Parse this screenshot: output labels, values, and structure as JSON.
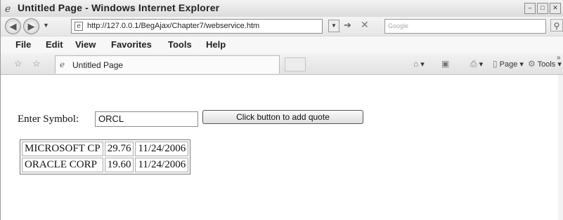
{
  "window": {
    "title": "Untitled Page - Windows Internet Explorer"
  },
  "address": {
    "url": "http://127.0.0.1/BegAjax/Chapter7/webservice.htm",
    "search_placeholder": "Google"
  },
  "menu": {
    "items": [
      "File",
      "Edit",
      "View",
      "Favorites",
      "Tools",
      "Help"
    ]
  },
  "tab": {
    "title": "Untitled Page"
  },
  "commands": {
    "page": "Page ▾",
    "tools": "Tools ▾"
  },
  "form": {
    "symbol_label": "Enter Symbol:",
    "symbol_value": "ORCL",
    "button_label": "Click button to add quote"
  },
  "quotes": {
    "rows": [
      {
        "name": "MICROSOFT CP",
        "price": "29.76",
        "date": "11/24/2006"
      },
      {
        "name": "ORACLE CORP",
        "price": "19.60",
        "date": "11/24/2006"
      }
    ]
  }
}
